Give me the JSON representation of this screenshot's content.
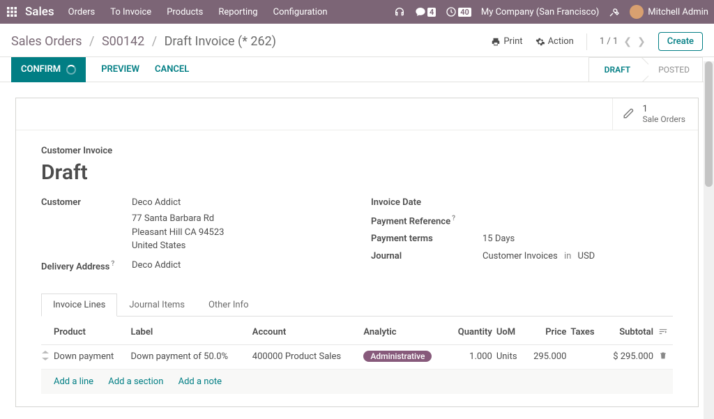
{
  "nav": {
    "brand": "Sales",
    "items": [
      "Orders",
      "To Invoice",
      "Products",
      "Reporting",
      "Configuration"
    ],
    "messages_badge": "4",
    "activities_badge": "40",
    "company": "My Company (San Francisco)",
    "user": "Mitchell Admin"
  },
  "breadcrumb": {
    "root": "Sales Orders",
    "order": "S00142",
    "current": "Draft Invoice (* 262)"
  },
  "cp": {
    "print": "Print",
    "action": "Action",
    "pager": "1 / 1",
    "create": "Create"
  },
  "status": {
    "confirm": "CONFIRM",
    "preview": "PREVIEW",
    "cancel": "CANCEL",
    "draft": "DRAFT",
    "posted": "POSTED"
  },
  "buttonbox": {
    "count": "1",
    "label": "Sale Orders"
  },
  "form": {
    "section": "Customer Invoice",
    "title": "Draft",
    "labels": {
      "customer": "Customer",
      "delivery": "Delivery Address",
      "invoice_date": "Invoice Date",
      "payment_ref": "Payment Reference",
      "payment_terms": "Payment terms",
      "journal": "Journal"
    },
    "customer": {
      "name": "Deco Addict",
      "street": "77 Santa Barbara Rd",
      "city": "Pleasant Hill CA 94523",
      "country": "United States"
    },
    "delivery_name": "Deco Addict",
    "payment_terms": "15 Days",
    "journal_name": "Customer Invoices",
    "journal_in": "in",
    "currency": "USD"
  },
  "tabs": {
    "lines": "Invoice Lines",
    "journal": "Journal Items",
    "other": "Other Info"
  },
  "table": {
    "headers": {
      "product": "Product",
      "label": "Label",
      "account": "Account",
      "analytic": "Analytic",
      "qty": "Quantity",
      "uom": "UoM",
      "price": "Price",
      "taxes": "Taxes",
      "subtotal": "Subtotal"
    },
    "rows": [
      {
        "product": "Down payment",
        "label": "Down payment of 50.0%",
        "account": "400000 Product Sales",
        "analytic": "Administrative",
        "qty": "1.000",
        "uom": "Units",
        "price": "295.000",
        "taxes": "",
        "subtotal": "$ 295.000"
      }
    ],
    "add_line": "Add a line",
    "add_section": "Add a section",
    "add_note": "Add a note"
  }
}
